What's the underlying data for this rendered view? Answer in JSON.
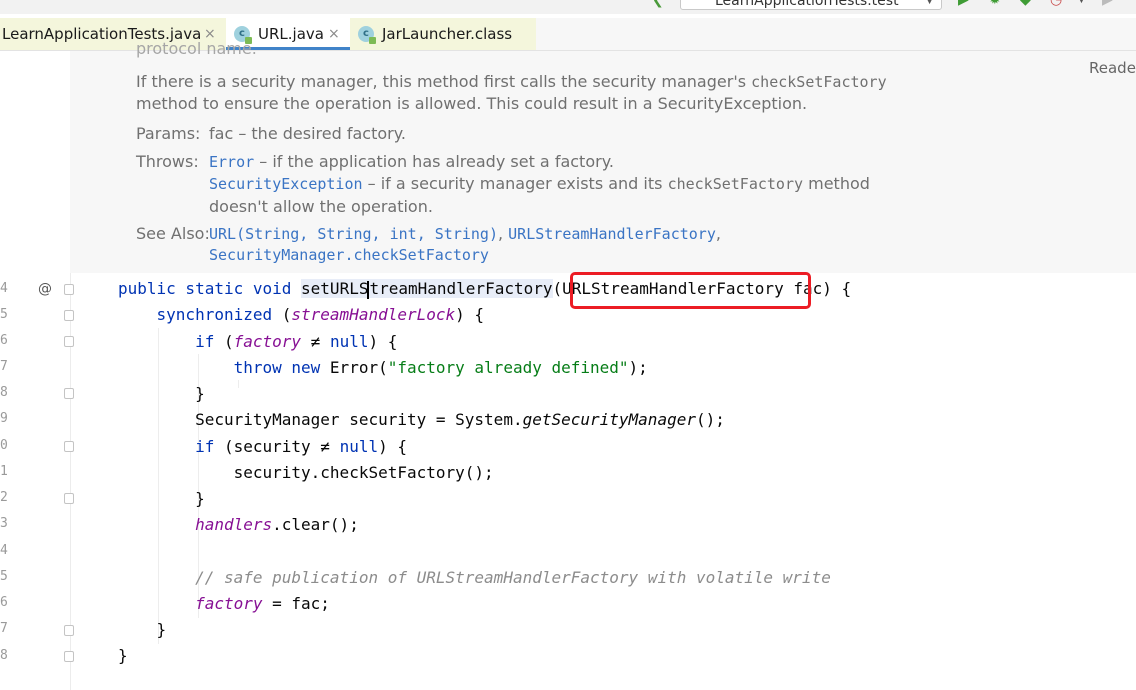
{
  "toolbar": {
    "run_config": "LearnApplicationTests.test",
    "icons": [
      "back-arrow-icon",
      "run-icon",
      "debug-icon",
      "coverage-icon",
      "profile-icon",
      "more-icon"
    ]
  },
  "tabs": [
    {
      "label": "LearnApplicationTests.java",
      "close": "×",
      "active": false
    },
    {
      "label": "URL.java",
      "close": "×",
      "active": true
    },
    {
      "label": "JarLauncher.class",
      "close": "",
      "active": false
    }
  ],
  "reader_mode": "Reade",
  "doc": {
    "line0": "protocol name.",
    "line1a": "If there is a security manager, this method first calls the security manager's ",
    "line1b": "checkSetFactory",
    "line2": "method to ensure the operation is allowed. This could result in a SecurityException.",
    "params_label": "Params:",
    "params_text": "fac – the desired factory.",
    "throws_label": "Throws:",
    "throws_1_link": "Error",
    "throws_1_text": " – if the application has already set a factory.",
    "throws_2_link": "SecurityException",
    "throws_2_text_a": " – if a security manager exists and its ",
    "throws_2_code": "checkSetFactory",
    "throws_2_text_b": " method",
    "throws_2_text_c": "doesn't allow the operation.",
    "see_also_label": "See Also:",
    "see_1": "URL(String, String, int, String)",
    "see_sep_1": ", ",
    "see_2": "URLStreamHandlerFactory",
    "see_sep_2": ",",
    "see_3": "SecurityManager.checkSetFactory"
  },
  "line_numbers": [
    "4",
    "5",
    "6",
    "7",
    "8",
    "9",
    "0",
    "1",
    "2",
    "3",
    "4",
    "5",
    "6",
    "7",
    "8"
  ],
  "code": {
    "l1": {
      "kw": "public static void ",
      "m_a": "setURLS",
      "m_b": "treamHandlerFactory",
      "p_open": "(",
      "type": "URLStreamHandlerFactory",
      "rest": " fac) {"
    },
    "l2": {
      "kw": "synchronized",
      "a": " (",
      "fld": "streamHandlerLock",
      "b": ") {"
    },
    "l3": {
      "kw": "if",
      "a": " (",
      "fld": "factory",
      "b": " ≠ ",
      "kw2": "null",
      "c": ") {"
    },
    "l4": {
      "kw": "throw new ",
      "a": "Error(",
      "str": "\"factory already defined\"",
      "b": ");"
    },
    "l5": {
      "a": "}"
    },
    "l6": {
      "a": "SecurityManager security = System.",
      "m": "getSecurityManager",
      "b": "();"
    },
    "l7": {
      "kw": "if",
      "a": " (security ≠ ",
      "kw2": "null",
      "b": ") {"
    },
    "l8": {
      "a": "security.checkSetFactory();"
    },
    "l9": {
      "a": "}"
    },
    "l10": {
      "fld": "handlers",
      "a": ".clear();"
    },
    "l11": {
      "cmt": "// safe publication of URLStreamHandlerFactory with volatile write"
    },
    "l12": {
      "fld": "factory",
      "a": " = fac;"
    },
    "l13": {
      "a": "}"
    },
    "l14": {
      "a": "}"
    }
  },
  "gutter": {
    "override_marker": "@"
  }
}
